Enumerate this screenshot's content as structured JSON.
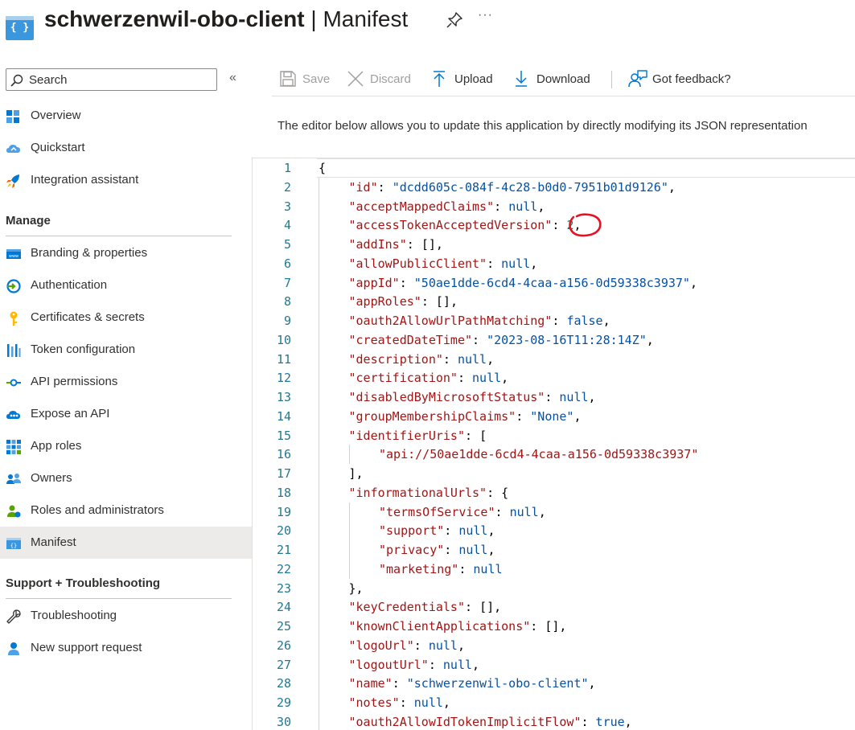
{
  "header": {
    "app_name": "schwerzenwil-obo-client",
    "separator": "|",
    "page": "Manifest",
    "app_icon_glyph": "{ }",
    "more_label": "···"
  },
  "sidebar": {
    "search_placeholder": "Search",
    "collapse_label": "«",
    "top_items": [
      {
        "label": "Overview",
        "icon": "overview-icon"
      },
      {
        "label": "Quickstart",
        "icon": "quickstart-cloud-icon"
      },
      {
        "label": "Integration assistant",
        "icon": "rocket-icon"
      }
    ],
    "manage_heading": "Manage",
    "manage_items": [
      {
        "label": "Branding & properties",
        "icon": "branding-icon"
      },
      {
        "label": "Authentication",
        "icon": "authentication-icon"
      },
      {
        "label": "Certificates & secrets",
        "icon": "key-icon"
      },
      {
        "label": "Token configuration",
        "icon": "token-bars-icon"
      },
      {
        "label": "API permissions",
        "icon": "api-permissions-icon"
      },
      {
        "label": "Expose an API",
        "icon": "expose-api-cloud-icon"
      },
      {
        "label": "App roles",
        "icon": "app-roles-grid-icon"
      },
      {
        "label": "Owners",
        "icon": "owners-people-icon"
      },
      {
        "label": "Roles and administrators",
        "icon": "roles-admin-icon"
      },
      {
        "label": "Manifest",
        "icon": "manifest-icon",
        "active": true
      }
    ],
    "support_heading": "Support + Troubleshooting",
    "support_items": [
      {
        "label": "Troubleshooting",
        "icon": "wrench-icon"
      },
      {
        "label": "New support request",
        "icon": "support-person-icon"
      }
    ]
  },
  "toolbar": {
    "save": "Save",
    "discard": "Discard",
    "upload": "Upload",
    "download": "Download",
    "feedback": "Got feedback?"
  },
  "description": "The editor below allows you to update this application by directly modifying its JSON representation",
  "editor": {
    "lines": [
      {
        "n": "1",
        "indent": 0,
        "key": "",
        "value": "",
        "vtype": "",
        "text": "{"
      },
      {
        "n": "2",
        "indent": 1,
        "key": "\"id\"",
        "value": "\"dcdd605c-084f-4c28-b0d0-7951b01d9126\"",
        "vtype": "s",
        "tail": ","
      },
      {
        "n": "3",
        "indent": 1,
        "key": "\"acceptMappedClaims\"",
        "value": "null",
        "vtype": "lit",
        "tail": ","
      },
      {
        "n": "4",
        "indent": 1,
        "key": "\"accessTokenAcceptedVersion\"",
        "value": "2",
        "vtype": "n",
        "tail": ","
      },
      {
        "n": "5",
        "indent": 1,
        "key": "\"addIns\"",
        "value": "[]",
        "vtype": "p",
        "tail": ","
      },
      {
        "n": "6",
        "indent": 1,
        "key": "\"allowPublicClient\"",
        "value": "null",
        "vtype": "lit",
        "tail": ","
      },
      {
        "n": "7",
        "indent": 1,
        "key": "\"appId\"",
        "value": "\"50ae1dde-6cd4-4caa-a156-0d59338c3937\"",
        "vtype": "s",
        "tail": ","
      },
      {
        "n": "8",
        "indent": 1,
        "key": "\"appRoles\"",
        "value": "[]",
        "vtype": "p",
        "tail": ","
      },
      {
        "n": "9",
        "indent": 1,
        "key": "\"oauth2AllowUrlPathMatching\"",
        "value": "false",
        "vtype": "lit",
        "tail": ","
      },
      {
        "n": "10",
        "indent": 1,
        "key": "\"createdDateTime\"",
        "value": "\"2023-08-16T11:28:14Z\"",
        "vtype": "s",
        "tail": ","
      },
      {
        "n": "11",
        "indent": 1,
        "key": "\"description\"",
        "value": "null",
        "vtype": "lit",
        "tail": ","
      },
      {
        "n": "12",
        "indent": 1,
        "key": "\"certification\"",
        "value": "null",
        "vtype": "lit",
        "tail": ","
      },
      {
        "n": "13",
        "indent": 1,
        "key": "\"disabledByMicrosoftStatus\"",
        "value": "null",
        "vtype": "lit",
        "tail": ","
      },
      {
        "n": "14",
        "indent": 1,
        "key": "\"groupMembershipClaims\"",
        "value": "\"None\"",
        "vtype": "s",
        "tail": ","
      },
      {
        "n": "15",
        "indent": 1,
        "key": "\"identifierUris\"",
        "value": "[",
        "vtype": "p",
        "tail": ""
      },
      {
        "n": "16",
        "indent": 2,
        "key": "",
        "value": "\"api://50ae1dde-6cd4-4caa-a156-0d59338c3937\"",
        "vtype": "k",
        "tail": ""
      },
      {
        "n": "17",
        "indent": 1,
        "key": "",
        "value": "],",
        "vtype": "p",
        "tail": ""
      },
      {
        "n": "18",
        "indent": 1,
        "key": "\"informationalUrls\"",
        "value": "{",
        "vtype": "p",
        "tail": ""
      },
      {
        "n": "19",
        "indent": 2,
        "key": "\"termsOfService\"",
        "value": "null",
        "vtype": "lit",
        "tail": ","
      },
      {
        "n": "20",
        "indent": 2,
        "key": "\"support\"",
        "value": "null",
        "vtype": "lit",
        "tail": ","
      },
      {
        "n": "21",
        "indent": 2,
        "key": "\"privacy\"",
        "value": "null",
        "vtype": "lit",
        "tail": ","
      },
      {
        "n": "22",
        "indent": 2,
        "key": "\"marketing\"",
        "value": "null",
        "vtype": "lit",
        "tail": ""
      },
      {
        "n": "23",
        "indent": 1,
        "key": "",
        "value": "},",
        "vtype": "p",
        "tail": ""
      },
      {
        "n": "24",
        "indent": 1,
        "key": "\"keyCredentials\"",
        "value": "[]",
        "vtype": "p",
        "tail": ","
      },
      {
        "n": "25",
        "indent": 1,
        "key": "\"knownClientApplications\"",
        "value": "[]",
        "vtype": "p",
        "tail": ","
      },
      {
        "n": "26",
        "indent": 1,
        "key": "\"logoUrl\"",
        "value": "null",
        "vtype": "lit",
        "tail": ","
      },
      {
        "n": "27",
        "indent": 1,
        "key": "\"logoutUrl\"",
        "value": "null",
        "vtype": "lit",
        "tail": ","
      },
      {
        "n": "28",
        "indent": 1,
        "key": "\"name\"",
        "value": "\"schwerzenwil-obo-client\"",
        "vtype": "s",
        "tail": ","
      },
      {
        "n": "29",
        "indent": 1,
        "key": "\"notes\"",
        "value": "null",
        "vtype": "lit",
        "tail": ","
      },
      {
        "n": "30",
        "indent": 1,
        "key": "\"oauth2AllowIdTokenImplicitFlow\"",
        "value": "true",
        "vtype": "lit",
        "tail": ","
      }
    ]
  },
  "colors": {
    "accent": "#0078d4",
    "annotation": "#e81123",
    "key": "#a31515",
    "string": "#0451a5",
    "number": "#098658"
  }
}
